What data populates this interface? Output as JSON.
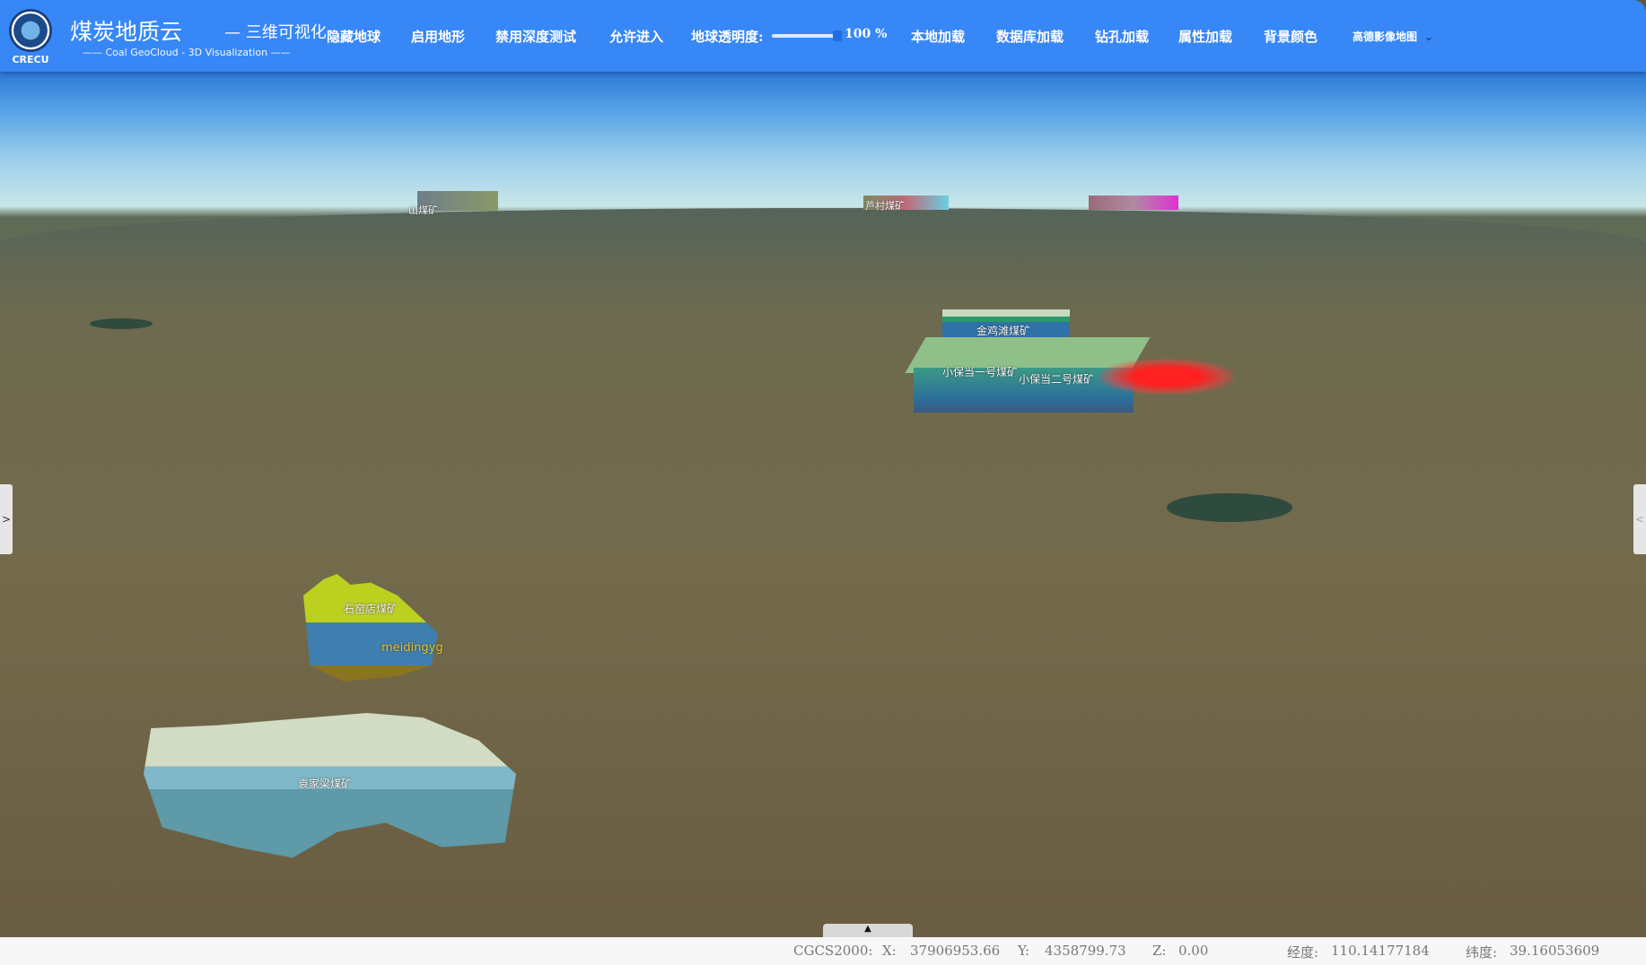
{
  "header": {
    "logo_text": "CRECU",
    "title": "煤炭地质云",
    "subtitle": "— 三维可视化",
    "subtitle_en": "—— Coal GeoCloud - 3D Visualization ——",
    "nav": [
      "隐藏地球",
      "启用地形",
      "禁用深度测试",
      "允许进入"
    ],
    "opacity_label": "地球透明度:",
    "opacity_value": "100 %",
    "opacity_fraction": 1.0,
    "nav2": [
      "本地加载",
      "数据库加载",
      "钻孔加载",
      "属性加载",
      "背景颜色"
    ],
    "basemap_select": "高德影像地图",
    "accent": "#3787f7"
  },
  "map": {
    "labels": {
      "jinjitan": "金鸡滩煤矿",
      "xbd1": "小保当一号煤矿",
      "xbd2": "小保当二号煤矿",
      "shiyaodian": "石窑店煤矿",
      "yuanjialiang": "袁家梁煤矿",
      "lucun": "芦村煤矿",
      "far_left": "山煤矿",
      "drill": "meidingyg"
    },
    "left_toggle": ">",
    "right_toggle": "<",
    "bottom_toggle": "▲"
  },
  "footer": {
    "crs": "CGCS2000:",
    "x_label": "X:",
    "x": "37906953.66",
    "y_label": "Y:",
    "y": "4358799.73",
    "z_label": "Z:",
    "z": "0.00",
    "lon_label": "经度:",
    "lon": "110.14177184",
    "lat_label": "纬度:",
    "lat": "39.16053609"
  }
}
